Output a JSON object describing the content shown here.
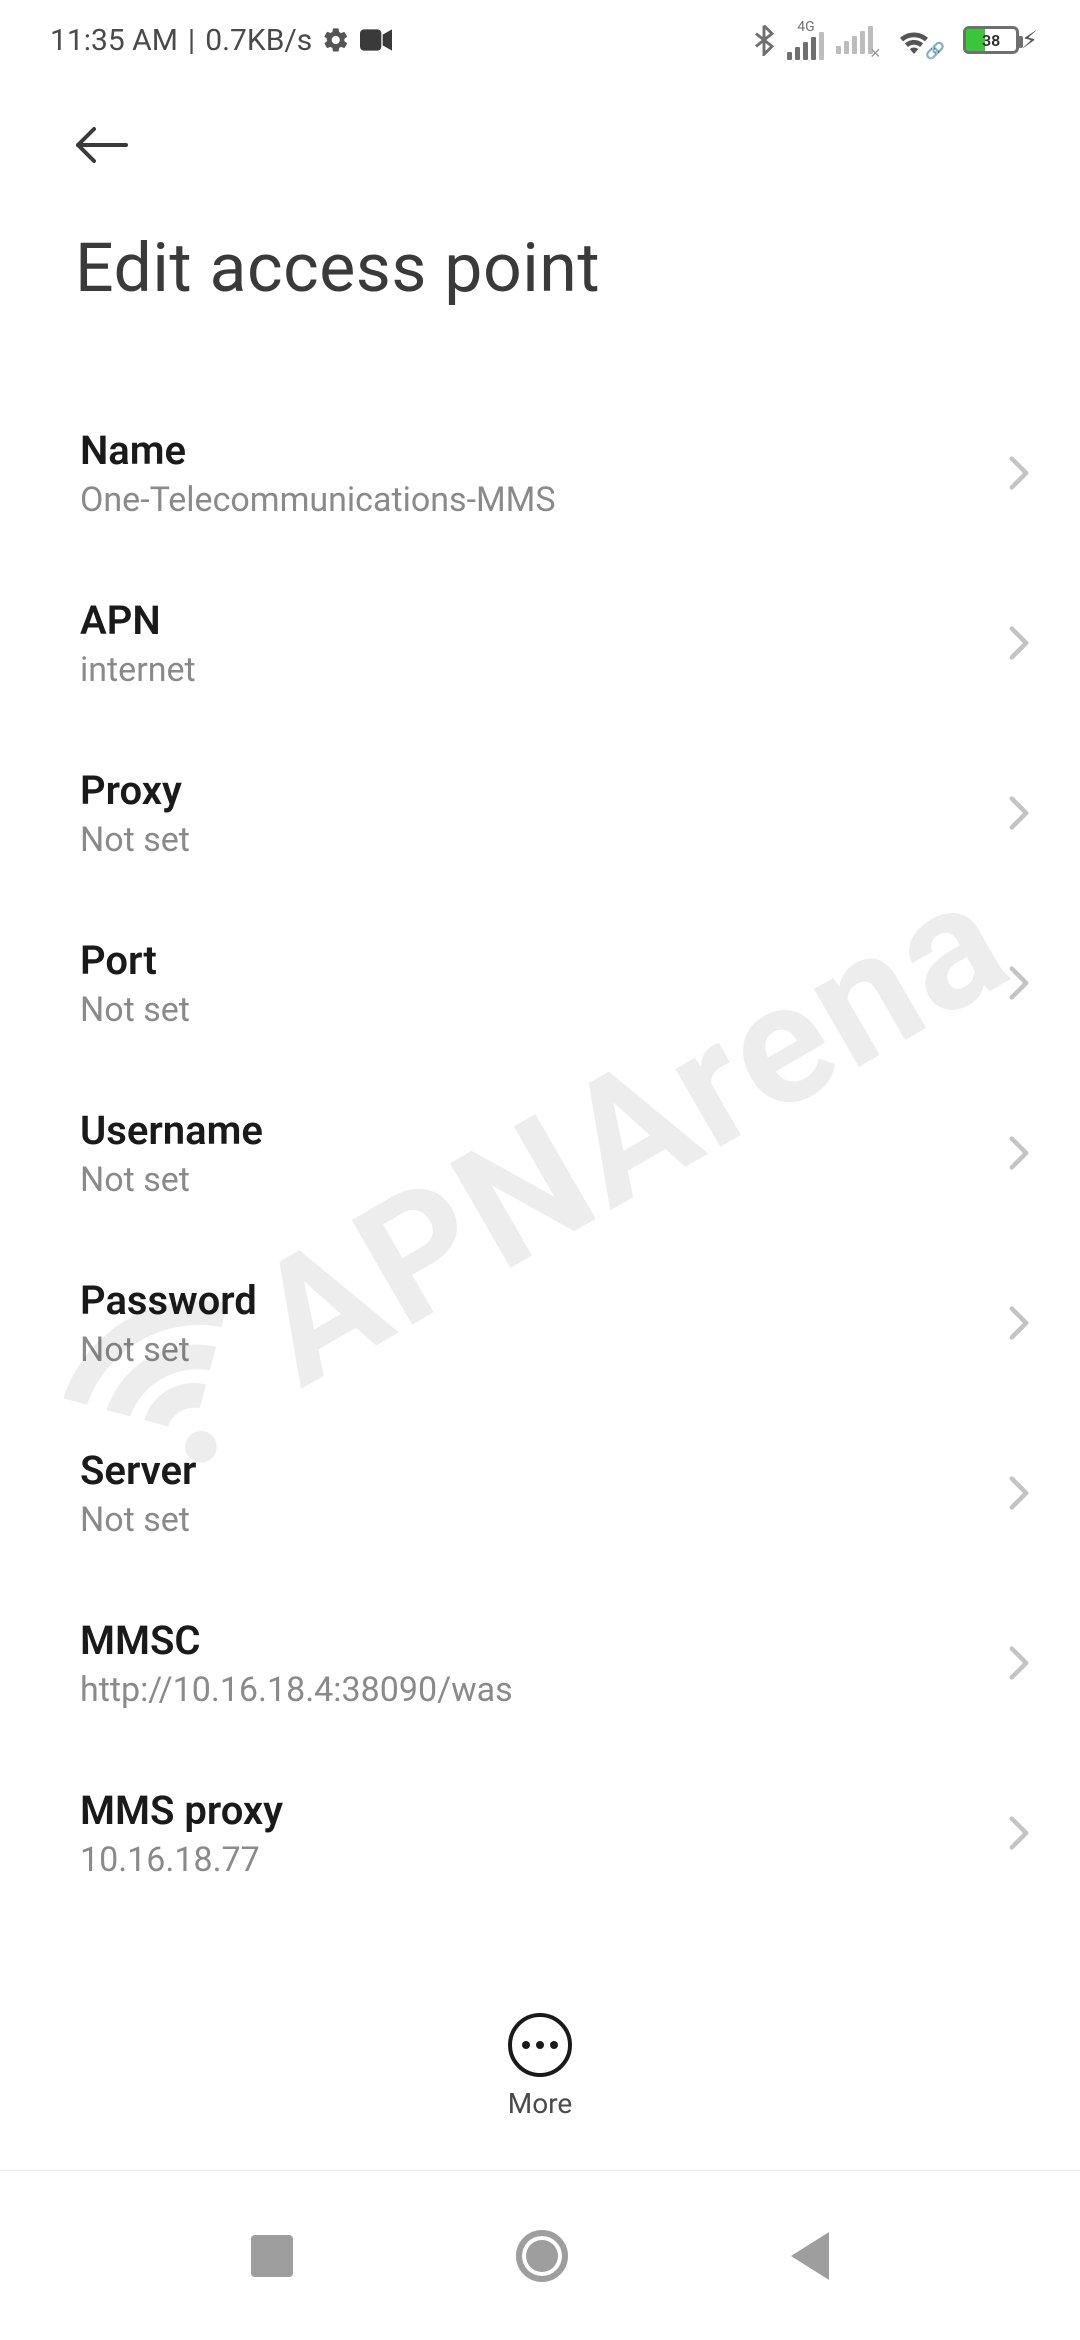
{
  "status_bar": {
    "time": "11:35 AM",
    "data_rate": "0.7KB/s",
    "signal_badge": "4G",
    "battery_percent": "38"
  },
  "header": {
    "title": "Edit access point"
  },
  "rows": [
    {
      "label": "Name",
      "value": "One-Telecommunications-MMS"
    },
    {
      "label": "APN",
      "value": "internet"
    },
    {
      "label": "Proxy",
      "value": "Not set"
    },
    {
      "label": "Port",
      "value": "Not set"
    },
    {
      "label": "Username",
      "value": "Not set"
    },
    {
      "label": "Password",
      "value": "Not set"
    },
    {
      "label": "Server",
      "value": "Not set"
    },
    {
      "label": "MMSC",
      "value": "http://10.16.18.4:38090/was"
    },
    {
      "label": "MMS proxy",
      "value": "10.16.18.77"
    }
  ],
  "more_label": "More",
  "watermark_text": "APNArena"
}
